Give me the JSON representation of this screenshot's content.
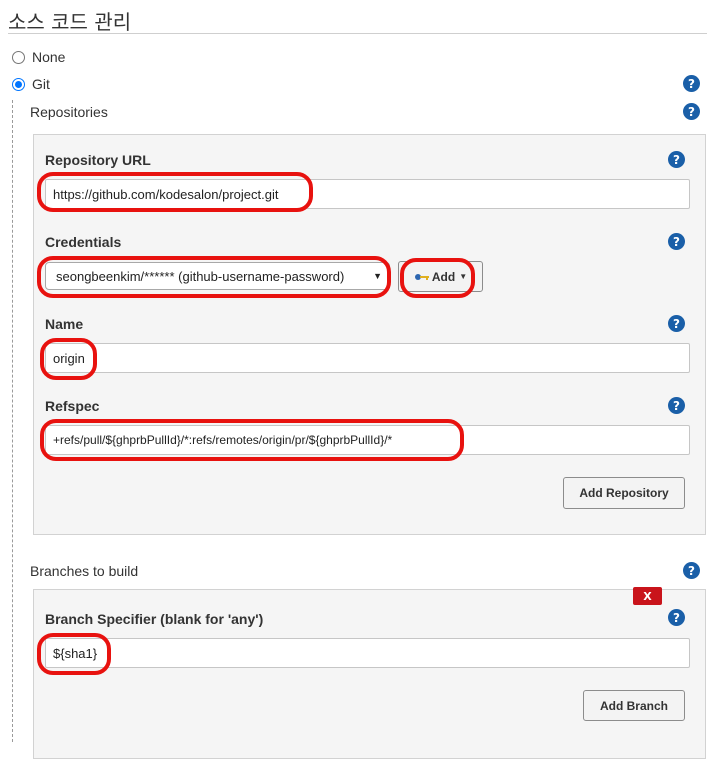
{
  "section": {
    "title": "소스 코드 관리"
  },
  "scm": {
    "none_label": "None",
    "git_label": "Git"
  },
  "repositories": {
    "label": "Repositories",
    "repository_url": {
      "label": "Repository URL",
      "value": "https://github.com/kodesalon/project.git"
    },
    "credentials": {
      "label": "Credentials",
      "selected": "seongbeenkim/****** (github-username-password)",
      "add_label": "Add"
    },
    "name": {
      "label": "Name",
      "value": "origin"
    },
    "refspec": {
      "label": "Refspec",
      "value": "+refs/pull/${ghprbPullId}/*:refs/remotes/origin/pr/${ghprbPullId}/*"
    },
    "add_repository_label": "Add Repository"
  },
  "branches": {
    "label": "Branches to build",
    "delete_label": "X",
    "specifier": {
      "label": "Branch Specifier (blank for 'any')",
      "value": "${sha1}"
    },
    "add_branch_label": "Add Branch"
  },
  "help_glyph": "?",
  "colors": {
    "accent": "#1a5fa8",
    "highlight": "#e8120f",
    "delete": "#c9141b",
    "radio": "#0075ff"
  }
}
